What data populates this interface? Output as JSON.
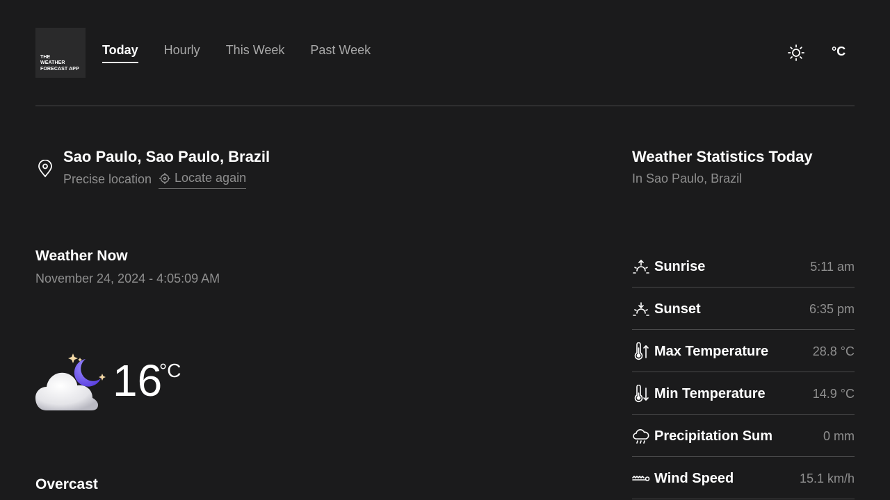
{
  "app": {
    "logo_text": "THE\nWEATHER\nFORECAST APP"
  },
  "nav": {
    "tabs": [
      {
        "label": "Today",
        "active": true
      },
      {
        "label": "Hourly",
        "active": false
      },
      {
        "label": "This Week",
        "active": false
      },
      {
        "label": "Past Week",
        "active": false
      }
    ]
  },
  "header": {
    "theme_icon": "sun-icon",
    "unit_label": "°C"
  },
  "location": {
    "icon": "map-pin-icon",
    "title": "Sao Paulo, Sao Paulo, Brazil",
    "precision_label": "Precise location",
    "locate_again_label": "Locate again",
    "locate_icon": "crosshair-icon"
  },
  "weather_now": {
    "title": "Weather Now",
    "datetime": "November 24, 2024 - 4:05:09 AM",
    "condition_icon": "cloud-moon-icon",
    "temperature": "16",
    "unit": "°C",
    "condition": "Overcast"
  },
  "stats": {
    "title": "Weather Statistics Today",
    "subtitle": "In Sao Paulo, Brazil",
    "items": [
      {
        "icon": "sunrise-icon",
        "label": "Sunrise",
        "value": "5:11 am"
      },
      {
        "icon": "sunset-icon",
        "label": "Sunset",
        "value": "6:35 pm"
      },
      {
        "icon": "thermometer-up-icon",
        "label": "Max Temperature",
        "value": "28.8 °C"
      },
      {
        "icon": "thermometer-down-icon",
        "label": "Min Temperature",
        "value": "14.9 °C"
      },
      {
        "icon": "rain-cloud-icon",
        "label": "Precipitation Sum",
        "value": "0 mm"
      },
      {
        "icon": "wind-icon",
        "label": "Wind Speed",
        "value": "15.1 km/h"
      }
    ]
  },
  "colors": {
    "background": "#1b1b1c",
    "text_primary": "#ffffff",
    "text_secondary": "#8e8e8e",
    "divider": "#4a4a4b",
    "accent_moon": "#6c5ce7"
  }
}
